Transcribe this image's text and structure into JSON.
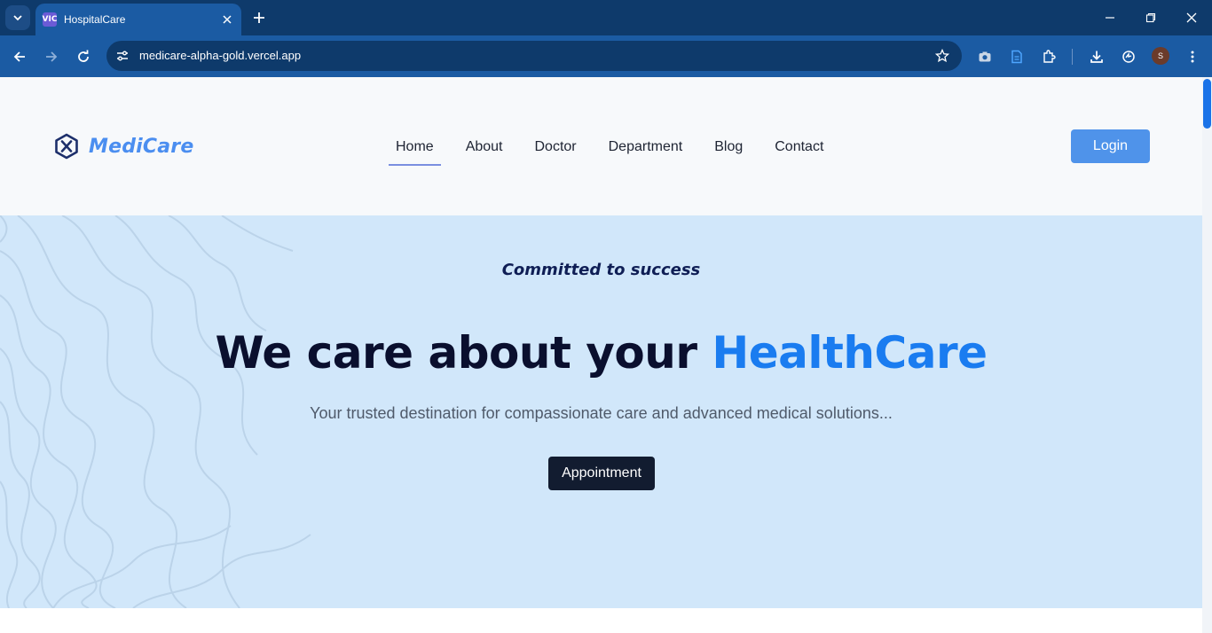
{
  "browser": {
    "tab_title": "HospitalCare",
    "favicon_text": "VIC",
    "url": "medicare-alpha-gold.vercel.app",
    "profile_initial": "S",
    "icons": [
      "tab-search-icon",
      "close-icon",
      "plus-icon",
      "minimize-icon",
      "restore-icon",
      "close-window-icon",
      "back-icon",
      "forward-icon",
      "reload-icon",
      "site-settings-icon",
      "star-icon",
      "camera-icon",
      "document-icon",
      "extension-icon",
      "download-icon",
      "sync-icon",
      "more-vert-icon"
    ]
  },
  "site": {
    "brand": "MediCare",
    "nav": [
      {
        "label": "Home",
        "active": true
      },
      {
        "label": "About",
        "active": false
      },
      {
        "label": "Doctor",
        "active": false
      },
      {
        "label": "Department",
        "active": false
      },
      {
        "label": "Blog",
        "active": false
      },
      {
        "label": "Contact",
        "active": false
      }
    ],
    "login_label": "Login"
  },
  "hero": {
    "tagline": "Committed to success",
    "title_main": "We care about your ",
    "title_accent": "HealthCare",
    "subtitle": "Your trusted destination for compassionate care and advanced medical solutions...",
    "cta_label": "Appointment"
  },
  "colors": {
    "chrome_dark": "#0e3a6b",
    "chrome_tab": "#1b5ba3",
    "brand_blue": "#4b8ef0",
    "hero_bg": "#d1e7fa",
    "accent": "#1a7cf0",
    "cta_dark": "#121c30"
  }
}
